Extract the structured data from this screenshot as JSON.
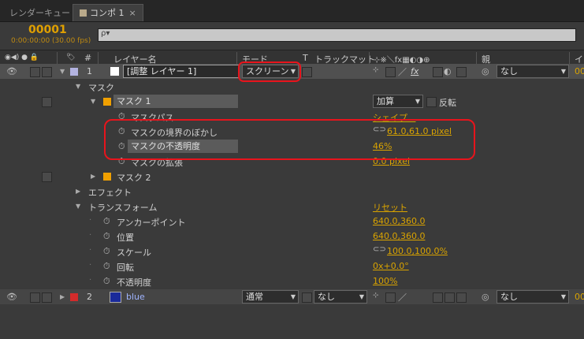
{
  "tabs": [
    {
      "label": "レンダーキュー"
    },
    {
      "label": "コンポ 1",
      "close": "×"
    }
  ],
  "timecode": "00001",
  "fps": "0:00:00:00 (30.00 fps)",
  "search": {
    "icon": "search-icon",
    "symbol": "ρ▾"
  },
  "columns": {
    "switches": "◉◀) ● 🔒",
    "tag": "🏷",
    "num": "#",
    "layer_name": "レイヤー名",
    "mode": "モード",
    "t": "T",
    "track_matte": "トラックマット",
    "switches2": "⊹※＼fx▦◐◑⊕",
    "parent": "親",
    "in": "イ"
  },
  "layer1": {
    "num": "1",
    "name": "[調整 レイヤー 1]",
    "mode": "スクリーン",
    "fx": "fx",
    "parent": "なし",
    "color": "#b3b3e0"
  },
  "mask_group": "マスク",
  "mask1": {
    "label": "マスク 1",
    "mode": "加算",
    "invert": "反転",
    "color": "#f0a000",
    "props": [
      {
        "name": "マスクパス",
        "value": "シェイプ..."
      },
      {
        "name": "マスクの境界のぼかし",
        "value": "61.0,61.0 pixel"
      },
      {
        "name": "マスクの不透明度",
        "value": "46%"
      },
      {
        "name": "マスクの拡張",
        "value": "0.0 pixel"
      }
    ]
  },
  "mask2": {
    "label": "マスク 2",
    "color": "#f0a000"
  },
  "effects": "エフェクト",
  "transform": {
    "label": "トランスフォーム",
    "reset": "リセット",
    "props": [
      {
        "name": "アンカーポイント",
        "value": "640.0,360.0"
      },
      {
        "name": "位置",
        "value": "640.0,360.0"
      },
      {
        "name": "スケール",
        "value": "100.0,100.0%"
      },
      {
        "name": "回転",
        "value": "0x+0.0°"
      },
      {
        "name": "不透明度",
        "value": "100%"
      }
    ]
  },
  "layer2": {
    "num": "2",
    "name": "blue",
    "mode": "通常",
    "track_matte": "なし",
    "parent": "なし",
    "label_color": "#d22b2b",
    "swatch_color": "#1a2a9a"
  }
}
